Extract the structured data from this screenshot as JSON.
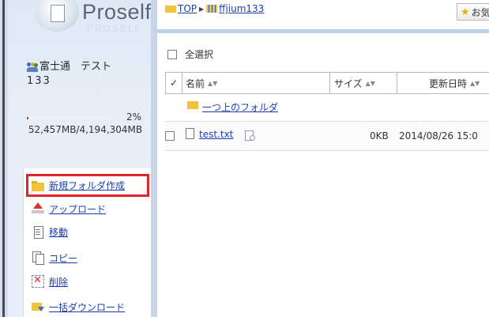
{
  "sidebar": {
    "logo_text": "Proself",
    "logo_ghost": "PROSELF",
    "user_name": "富士通　テスト",
    "user_name_cont": "133",
    "quota_percent": "2%",
    "quota_fill_fraction": 0.02,
    "quota_text": "52,457MB/4,194,304MB",
    "actions": [
      {
        "label": "新規フォルダ作成",
        "icon": "folder-new-icon",
        "highlighted": true
      },
      {
        "label": "アップロード",
        "icon": "upload-icon"
      },
      {
        "label": "移動",
        "icon": "move-icon"
      },
      {
        "label": "コピー",
        "icon": "copy-icon"
      },
      {
        "label": "削除",
        "icon": "delete-icon"
      },
      {
        "label": "一括ダウンロード",
        "icon": "batch-download-icon"
      }
    ]
  },
  "breadcrumb": {
    "root": "TOP",
    "current": "ffjium133"
  },
  "favorite_button": "お気",
  "select_all_label": "全選択",
  "table": {
    "headers": {
      "name": "名前",
      "size": "サイズ",
      "modified": "更新日時"
    },
    "sort_glyph": "▲▼",
    "parent_folder_label": "一つ上のフォルダ",
    "rows": [
      {
        "name": "test.txt",
        "size": "0KB",
        "modified": "2014/08/26 15:0"
      }
    ]
  },
  "colors": {
    "accent_link": "#1a3fb0",
    "highlight": "#e3222a",
    "folder": "#f2c23b",
    "sidebar_bg": "#e3ebf6"
  }
}
